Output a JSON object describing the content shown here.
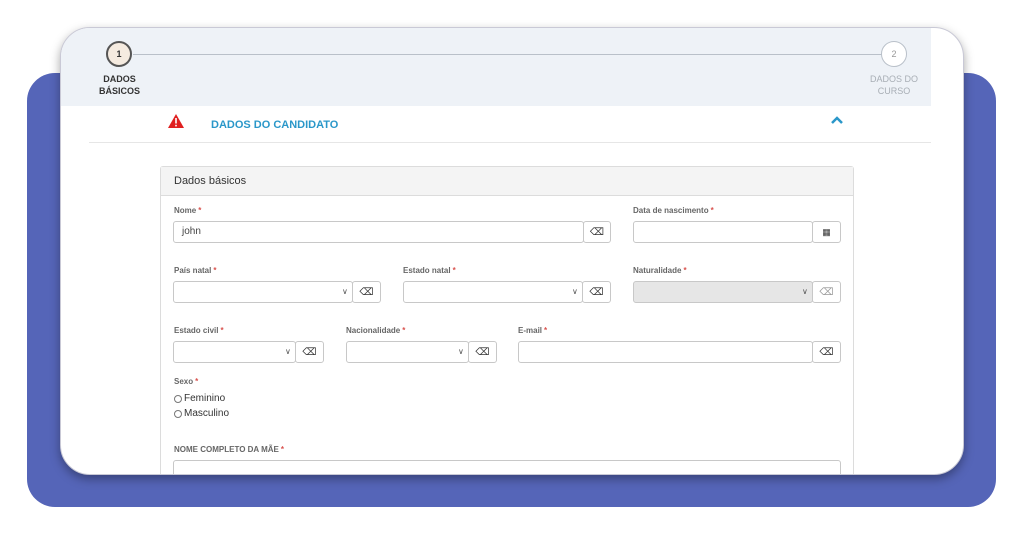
{
  "stepper": {
    "step1": {
      "number": "1",
      "label_line1": "DADOS",
      "label_line2": "BÁSICOS"
    },
    "step2": {
      "number": "2",
      "label_line1": "DADOS DO",
      "label_line2": "CURSO"
    }
  },
  "section": {
    "title": "DADOS DO CANDIDATO"
  },
  "panel": {
    "title": "Dados básicos"
  },
  "fields": {
    "nome": {
      "label": "Nome",
      "value": "john"
    },
    "data_nascimento": {
      "label": "Data de nascimento",
      "value": ""
    },
    "pais_natal": {
      "label": "País natal",
      "value": ""
    },
    "estado_natal": {
      "label": "Estado natal",
      "value": ""
    },
    "naturalidade": {
      "label": "Naturalidade",
      "value": ""
    },
    "estado_civil": {
      "label": "Estado civil",
      "value": ""
    },
    "nacionalidade": {
      "label": "Nacionalidade",
      "value": ""
    },
    "email": {
      "label": "E-mail",
      "value": ""
    },
    "sexo": {
      "label": "Sexo",
      "options": [
        "Feminino",
        "Masculino"
      ]
    },
    "nome_mae": {
      "label": "NOME COMPLETO DA MÃE",
      "value": ""
    }
  },
  "required_mark": "*",
  "icons": {
    "clear": "eraser-icon",
    "calendar": "calendar-icon",
    "dropdown": "chevron-down-icon",
    "warning": "warning-icon",
    "collapse": "chevron-up-icon"
  },
  "colors": {
    "accent": "#2a97c9",
    "required": "#d9534f",
    "warning": "#e02020",
    "frame": "#5565b8"
  }
}
